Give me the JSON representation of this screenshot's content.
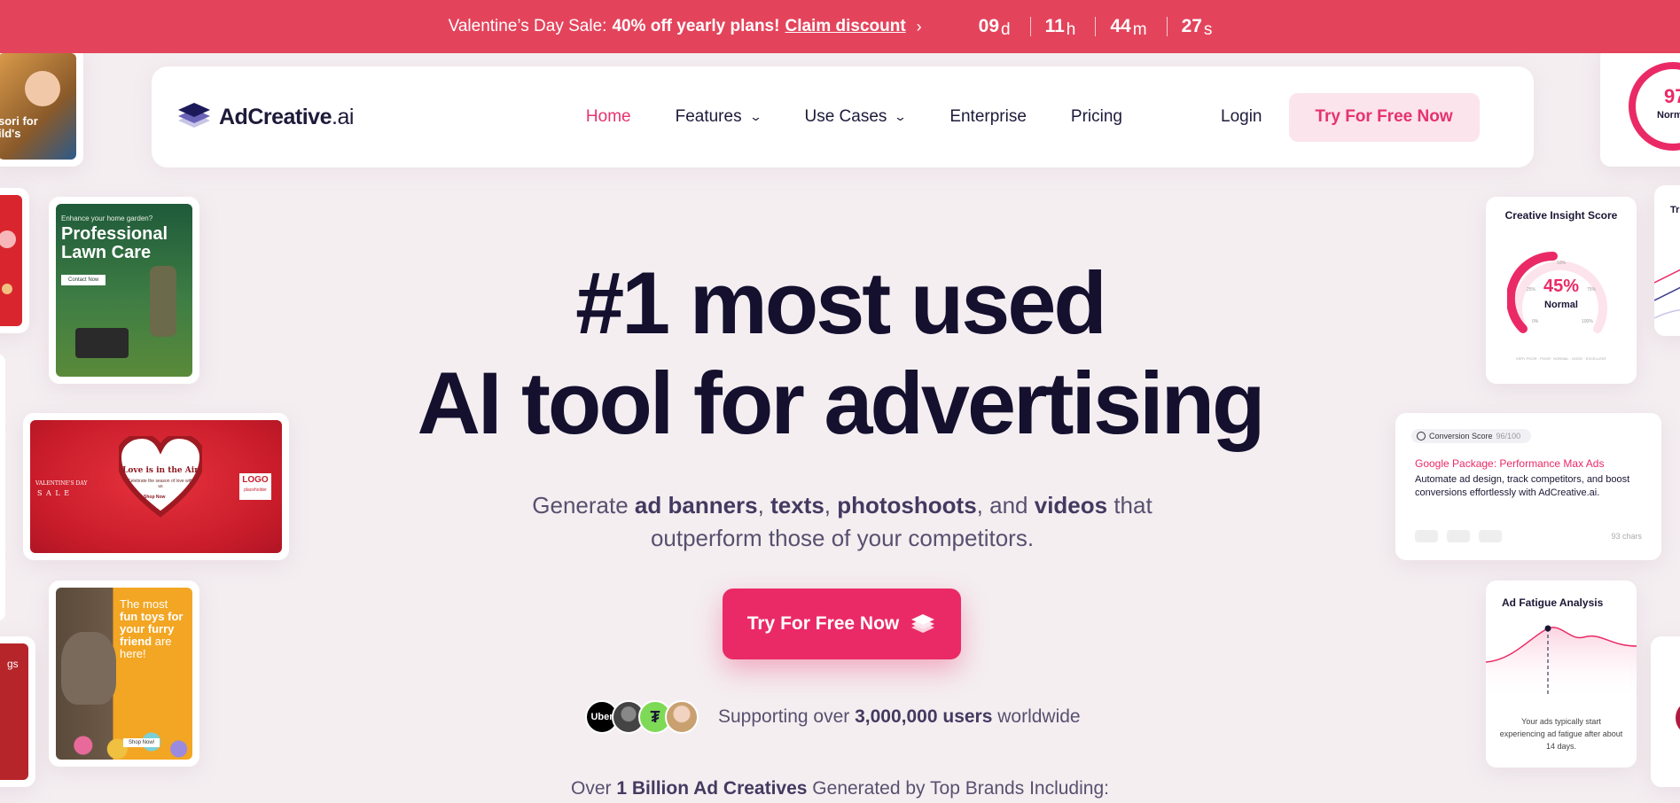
{
  "promo": {
    "prefix": "Valentine’s Day Sale:",
    "highlight": "40% off yearly plans!",
    "link": "Claim discount",
    "countdown": [
      {
        "value": "09",
        "unit": "d"
      },
      {
        "value": "11",
        "unit": "h"
      },
      {
        "value": "44",
        "unit": "m"
      },
      {
        "value": "27",
        "unit": "s"
      }
    ]
  },
  "nav": {
    "logo_main": "AdCreative",
    "logo_suffix": ".ai",
    "items": [
      {
        "label": "Home",
        "active": true
      },
      {
        "label": "Features",
        "dropdown": true
      },
      {
        "label": "Use Cases",
        "dropdown": true
      },
      {
        "label": "Enterprise"
      },
      {
        "label": "Pricing"
      }
    ],
    "login": "Login",
    "cta": "Try For Free Now"
  },
  "hero": {
    "title_line1": "#1 most used",
    "title_line2": "AI tool for advertising",
    "sub": {
      "p1": "Generate ",
      "b1": "ad banners",
      "p2": ", ",
      "b2": "texts",
      "p3": ", ",
      "b3": "photoshoots",
      "p4": ", and ",
      "b4": "videos",
      "p5": " that outperform those of your competitors."
    },
    "cta": "Try For Free Now",
    "social": {
      "avatar1": "Uber",
      "prefix": "Supporting over ",
      "bold": "3,000,000 users",
      "suffix": " worldwide"
    },
    "brands": {
      "prefix": "Over ",
      "bold": "1 Billion Ad Creatives",
      "suffix": " Generated by Top Brands Including:"
    }
  },
  "ads": {
    "montessori": {
      "text": "sori for\nild's"
    },
    "lawn": {
      "kicker": "Enhance your home garden?",
      "title": "Professional\nLawn Care",
      "button": "Contact Now"
    },
    "valentine": {
      "side": "VALENTINE'S DAY",
      "sale": "S A L E",
      "heading": "Love is in the Air",
      "body": "Celebrate the season of love with us",
      "button": "Shop Now",
      "logo": "LOGO",
      "logo_sub": "placeholder"
    },
    "dog": {
      "line1": "The most",
      "line2": "fun toys for",
      "line3": "your furry",
      "line4": "friend",
      "line5": "are here!",
      "button": "Shop Now!"
    },
    "partial_left": {
      "text": "gs"
    }
  },
  "panels": {
    "insight": {
      "title": "Creative Insight Score",
      "value": "45%",
      "label": "Normal",
      "t10": "10%",
      "t25": "25%",
      "t75": "75%",
      "t0": "0%",
      "t100": "100%",
      "scale": "VERY POOR · POOR · NORMAL · GOOD · EXCELLENT"
    },
    "top_right": {
      "value": "97",
      "label": "Norm"
    },
    "edge": {
      "text": "Tr"
    },
    "conversion": {
      "badge": "Conversion Score",
      "score": "96/100",
      "title": "Google Package: Performance Max Ads",
      "body": "Automate ad design, track competitors, and boost conversions effortlessly with AdCreative.ai.",
      "chars": "93 chars"
    },
    "fatigue": {
      "title": "Ad Fatigue Analysis",
      "body": "Your ads typically start experiencing ad fatigue after about 14 days."
    }
  },
  "colors": {
    "accent": "#e5336f",
    "promo_bg": "#e3445c",
    "heading": "#14102e"
  }
}
